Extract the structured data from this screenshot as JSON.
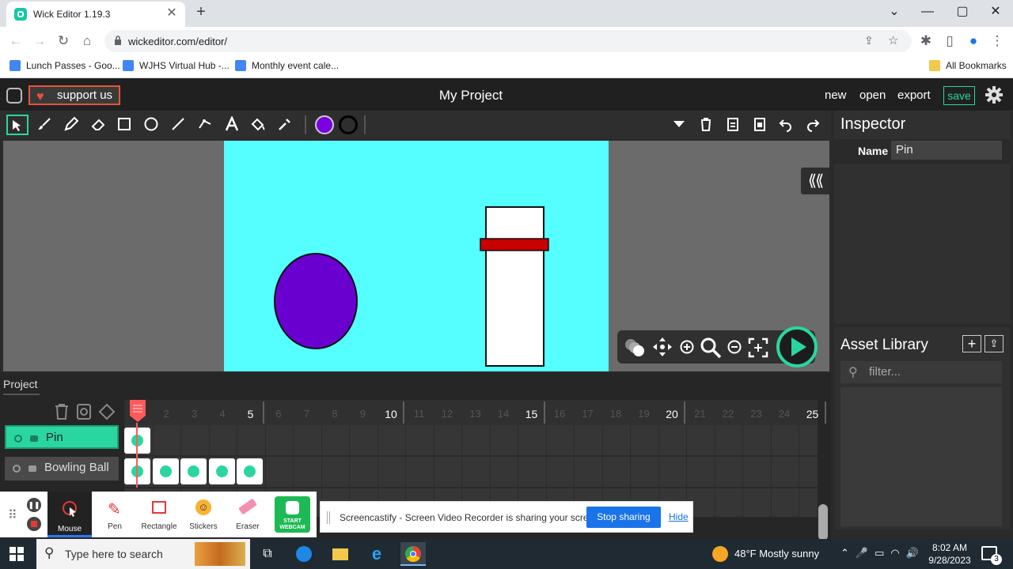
{
  "browser": {
    "tab_title": "Wick Editor 1.19.3",
    "url": "wickeditor.com/editor/",
    "bookmarks": [
      "Lunch Passes - Goo...",
      "WJHS Virtual Hub -...",
      "Monthly event cale..."
    ],
    "all_bookmarks": "All Bookmarks",
    "colors": {
      "tabstrip": "#dee1e6",
      "favicon": "#12c9a3"
    }
  },
  "wick": {
    "support_label": "support us",
    "project_title": "My Project",
    "menu": {
      "new": "new",
      "open": "open",
      "export": "export",
      "save": "save"
    },
    "tools": [
      "cursor-icon",
      "brush-icon",
      "pencil-icon",
      "eraser-icon",
      "rectangle-icon",
      "ellipse-icon",
      "line-icon",
      "path-icon",
      "text-icon",
      "fill-bucket-icon",
      "eyedropper-icon"
    ],
    "fill_color": "#7a00e0",
    "stroke_color": "#000000",
    "stage_color": "#55feff",
    "inspector": {
      "title": "Inspector",
      "name_label": "Name",
      "name_value": "Pin"
    },
    "asset_library": {
      "title": "Asset Library",
      "filter_placeholder": "filter..."
    },
    "timeline": {
      "project_tab": "Project",
      "frame_numbers": [
        "1",
        "2",
        "3",
        "4",
        "5",
        "6",
        "7",
        "8",
        "9",
        "10",
        "11",
        "12",
        "13",
        "14",
        "15",
        "16",
        "17",
        "18",
        "19",
        "20",
        "21",
        "22",
        "23",
        "24",
        "25"
      ],
      "layers": [
        {
          "name": "Pin",
          "active": true
        },
        {
          "name": "Bowling Ball",
          "active": false
        }
      ]
    }
  },
  "screencastify": {
    "tools": [
      "Mouse",
      "Pen",
      "Rectangle",
      "Stickers",
      "Eraser"
    ],
    "webcam": "START WEBCAM",
    "share_message": "Screencastify - Screen Video Recorder is sharing your screen.",
    "stop_label": "Stop sharing",
    "hide_label": "Hide"
  },
  "taskbar": {
    "search_placeholder": "Type here to search",
    "weather": "48°F  Mostly sunny",
    "time": "8:02 AM",
    "date": "9/28/2023",
    "notifications": "3"
  }
}
